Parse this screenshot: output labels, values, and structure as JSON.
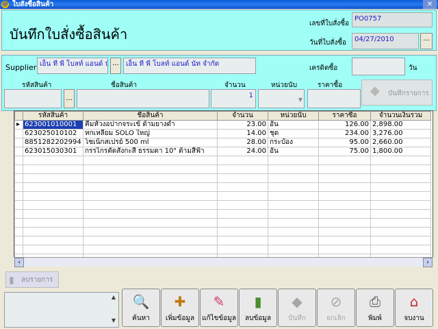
{
  "window": {
    "title": "ใบสั่งซื้อสินค้า",
    "close_glyph": "✕"
  },
  "header": {
    "page_title": "บันทึกใบสั่งซื้อสินค้า",
    "po_label": "เลขที่ใบสั่งซื้อ",
    "po_value": "PO0757",
    "date_label": "วันที่ใบสั่งซื้อ",
    "date_value": "04/27/2010",
    "date_btn": "..."
  },
  "supplier": {
    "label": "Supplier",
    "code": "เอ็น ที พี โบลท์ แอนด์ นั",
    "name": "เอ็น ที พี โบลท์ แอนด์ นัท จำกัด",
    "btn": "...",
    "credit_label": "เครดิตซื้อ",
    "credit_value": "",
    "days_label": "วัน"
  },
  "entry": {
    "code_label": "รหัสสินค้า",
    "name_label": "ชื่อสินค้า",
    "qty_label": "จำนวน",
    "unit_label": "หน่วยนับ",
    "price_label": "ราคาซื้อ",
    "qty_value": "1",
    "btn": "...",
    "save_item_label": "บันทึกรายการ"
  },
  "grid": {
    "columns": [
      "รหัสสินค้า",
      "ชื่อสินค้า",
      "จำนวน",
      "หน่วยนับ",
      "ราคาซื้อ",
      "จำนวนเงินรวม"
    ],
    "rows": [
      [
        "623001010001",
        "คีมหัวงอปากจระเข้ ด้ามยางดำ",
        "23.00",
        "อัน",
        "126.00",
        "2,898.00"
      ],
      [
        "623025010102",
        "หกเหลี่ยม SOLO ใหญ่",
        "14.00",
        "ชุด",
        "234.00",
        "3,276.00"
      ],
      [
        "8851282202994",
        "โซเน็กสเปรย์ 500 ml",
        "28.00",
        "กระป๋อง",
        "95.00",
        "2,660.00"
      ],
      [
        "623015030301",
        "กรรไกรตัดสังกะสี ธรรมดา 10\" ด้ามสีฟ้า",
        "24.00",
        "อัน",
        "75.00",
        "1,800.00"
      ]
    ],
    "row_marker": "▸"
  },
  "delete_row_label": "ลบรายการ",
  "toolbar": {
    "search": "ค้นหา",
    "add": "เพิ่มข้อมูล",
    "edit": "แก้ไขข้อมูล",
    "delete": "ลบข้อมูล",
    "save": "บันทึก",
    "cancel": "ยกเลิก",
    "print": "พิมพ์",
    "exit": "จบงาน"
  }
}
